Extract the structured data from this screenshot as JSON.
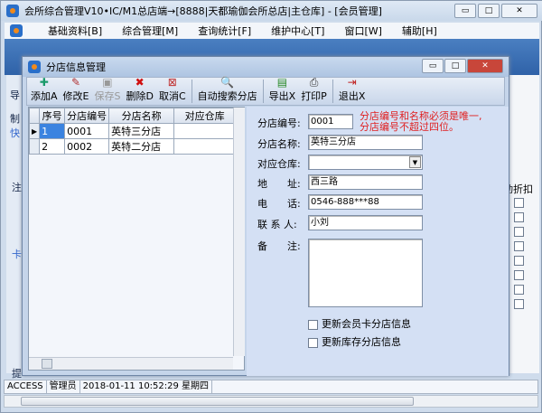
{
  "window": {
    "title": "会所综合管理V10•IC/M1总店端→[8888|天都瑜伽会所总店|主仓库] - [会员管理]",
    "min": "▭",
    "max": "□",
    "close": "✕"
  },
  "menu": [
    "基础资料[B]",
    "综合管理[M]",
    "查询统计[F]",
    "维护中心[T]",
    "窗口[W]",
    "辅助[H]"
  ],
  "child": {
    "title": "分店信息管理",
    "toolbar": [
      {
        "label": "添加A",
        "icon": "✚",
        "name": "add",
        "color": "#1a9a6a"
      },
      {
        "label": "修改E",
        "icon": "✎",
        "name": "edit",
        "color": "#b03030"
      },
      {
        "label": "保存S",
        "icon": "▣",
        "name": "save",
        "color": "#999",
        "disabled": true
      },
      {
        "label": "删除D",
        "icon": "✖",
        "name": "delete",
        "color": "#d01010"
      },
      {
        "label": "取消C",
        "icon": "⊠",
        "name": "cancel",
        "color": "#c03030"
      },
      {
        "label": "自动搜索分店",
        "icon": "🔍",
        "name": "auto-search",
        "color": "#333"
      },
      {
        "label": "导出X",
        "icon": "▤",
        "name": "export",
        "color": "#2a8a2a"
      },
      {
        "label": "打印P",
        "icon": "⎙",
        "name": "print",
        "color": "#333"
      },
      {
        "label": "退出X",
        "icon": "⇥",
        "name": "exit",
        "color": "#c02020"
      }
    ],
    "grid": {
      "columns": [
        "序号",
        "分店编号",
        "分店名称",
        "对应仓库"
      ],
      "rows": [
        [
          "1",
          "0001",
          "英特三分店",
          ""
        ],
        [
          "2",
          "0002",
          "英特二分店",
          ""
        ]
      ]
    },
    "form": {
      "code_label": "分店编号:",
      "code": "0001",
      "note1": "分店编号和名称必须是唯一,",
      "note2": "分店编号不超过四位。",
      "name_label": "分店名称:",
      "name": "英特三分店",
      "wh_label": "对应仓库:",
      "wh": "",
      "addr_label": "地　　址:",
      "addr": "西三路",
      "tel_label": "电　　话:",
      "tel": "0546-888***88",
      "contact_label": "联 系 人:",
      "contact": "小刘",
      "remark_label": "备　　注:",
      "remark": "",
      "chk1": "更新会员卡分店信息",
      "chk2": "更新库存分店信息"
    }
  },
  "status": {
    "db": "ACCESS",
    "user": "管理员",
    "datetime": "2018-01-11 10:52:29 星期四"
  },
  "background": {
    "left": [
      "导",
      "制",
      "快",
      "注",
      "卡",
      "提"
    ],
    "right_col": "动折扣"
  },
  "colors": {
    "note": "#e02020"
  }
}
